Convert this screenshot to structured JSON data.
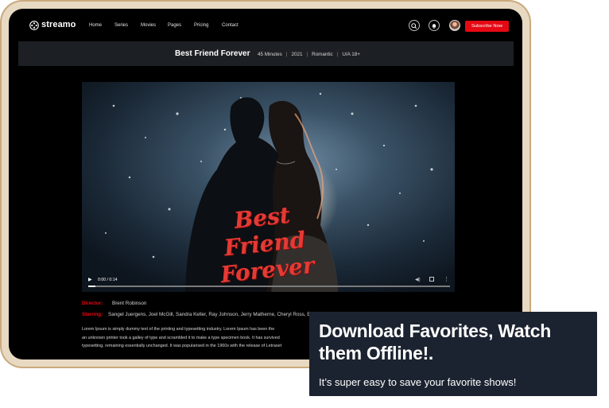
{
  "app": {
    "logo_text": "streamo",
    "nav": [
      "Home",
      "Series",
      "Movies",
      "Pages",
      "Pricing",
      "Contact"
    ],
    "subscribe_label": "Subscribe Now"
  },
  "movie": {
    "title": "Best Friend Forever",
    "duration": "45 Minutes",
    "year": "2021",
    "genre": "Romantic",
    "rating": "U/A 18+",
    "poster_title_line1": "Best Friend",
    "poster_title_line2": "Forever"
  },
  "player": {
    "time": "0:00 / 0:14",
    "progress": 0.0
  },
  "details": {
    "director_label": "Director:",
    "director": "Brent Robinson",
    "starring_label": "Starring:",
    "starring": "Sangel Juergens, Joel McGill, Sandra Keller, Ray Johnson, Jerry Matherne, Cheryl Ross, Ed and Eddy",
    "description_lines": [
      "Lorem Ipsum is simply dummy text of the printing and typesetting industry. Lorem Ipsum has been the",
      "an unknown printer took a galley of type and scrambled it to make a type specimen book. It has survived",
      "typesetting, remaining essentially unchanged. It was popularised in the 1960s with the release of Letraset"
    ]
  },
  "callout": {
    "heading": "Download Favorites, Watch them Offline!.",
    "subtext": "It’s super easy to save your favorite shows!"
  },
  "colors": {
    "accent": "#e50914",
    "frame": "#caa97c",
    "callout_bg": "#1c2330"
  },
  "icons": [
    "search-icon",
    "notification-icon",
    "play-icon",
    "volume-icon",
    "fullscreen-icon",
    "more-icon"
  ]
}
